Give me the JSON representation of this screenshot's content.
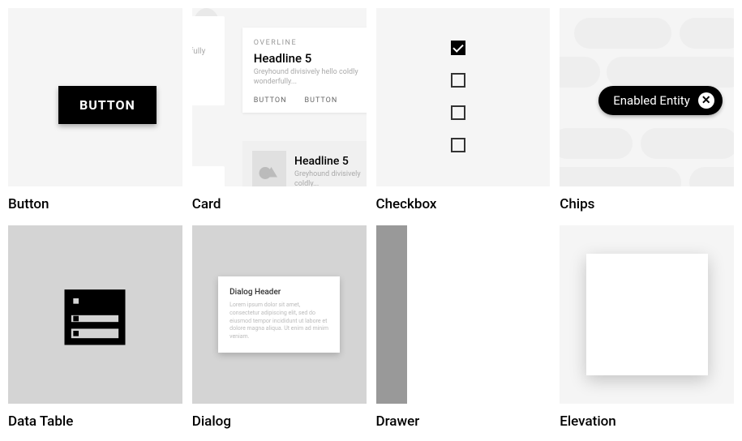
{
  "tiles": {
    "button": {
      "label": "Button",
      "button_text": "BUTTON"
    },
    "card": {
      "label": "Card",
      "ghost_text": "fully",
      "overline": "OVERLINE",
      "headline": "Headline 5",
      "body": "Greyhound divisively hello coldly wonderfully...",
      "action1": "BUTTON",
      "action2": "BUTTON",
      "media_headline": "Headline 5",
      "media_body": "Greyhound divisively coldly..."
    },
    "checkbox": {
      "label": "Checkbox"
    },
    "chips": {
      "label": "Chips",
      "chip_text": "Enabled Entity"
    },
    "datatable": {
      "label": "Data Table"
    },
    "dialog": {
      "label": "Dialog",
      "header": "Dialog Header",
      "body": "Lorem ipsum dolor sit amet, consectetur adipiscing elit, sed do eiusmod tempor incididunt ut labore et dolore magna aliqua. Ut enim ad minim veniam."
    },
    "drawer": {
      "label": "Drawer"
    },
    "elevation": {
      "label": "Elevation"
    }
  }
}
